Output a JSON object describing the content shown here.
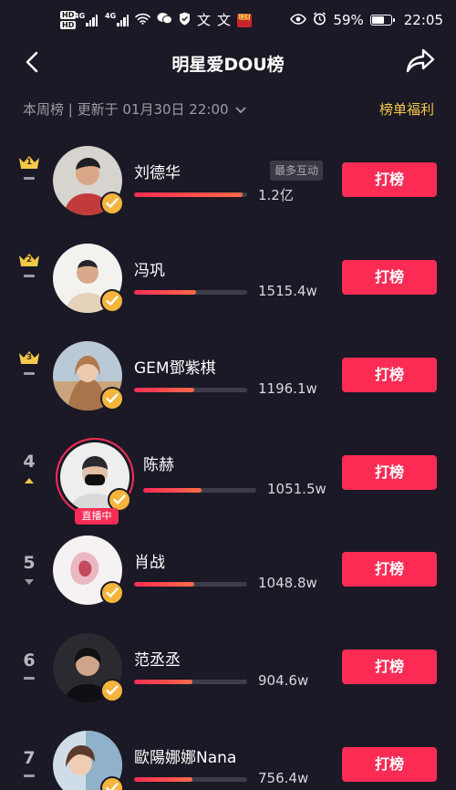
{
  "status_bar": {
    "hd_top": "HD",
    "hd_bottom": "HD",
    "network_1": "4G",
    "network_2": "4G",
    "tag_text": "理财",
    "battery": "59%",
    "time": "22:05"
  },
  "header": {
    "title": "明星爱DOU榜"
  },
  "subheader": {
    "week_info": "本周榜 | 更新于 01月30日 22:00",
    "benefit_link": "榜单福利"
  },
  "colors": {
    "background": "#1a1925",
    "accent": "#fe2c55",
    "gold": "#f4c84a",
    "muted_text": "#9d9ca5"
  },
  "ranking": [
    {
      "rank": "1",
      "name": "刘德华",
      "score": "1.2亿",
      "tag": "最多互动",
      "progress": 0.96,
      "trend": "flat",
      "live": false,
      "button_label": "打榜",
      "avatar_color": "#c23b3b"
    },
    {
      "rank": "2",
      "name": "冯巩",
      "score": "1515.4w",
      "tag": "",
      "progress": 0.55,
      "trend": "flat",
      "live": false,
      "button_label": "打榜",
      "avatar_color": "#e8d9c2"
    },
    {
      "rank": "3",
      "name": "GEM鄧紫棋",
      "score": "1196.1w",
      "tag": "",
      "progress": 0.53,
      "trend": "flat",
      "live": false,
      "button_label": "打榜",
      "avatar_color": "#c89b6e"
    },
    {
      "rank": "4",
      "name": "陈赫",
      "score": "1051.5w",
      "tag": "",
      "progress": 0.52,
      "trend": "up",
      "live": true,
      "live_label": "直播中",
      "button_label": "打榜",
      "avatar_color": "#e9e9e9"
    },
    {
      "rank": "5",
      "name": "肖战",
      "score": "1048.8w",
      "tag": "",
      "progress": 0.53,
      "trend": "down",
      "live": false,
      "button_label": "打榜",
      "avatar_color": "#f1e9ea"
    },
    {
      "rank": "6",
      "name": "范丞丞",
      "score": "904.6w",
      "tag": "",
      "progress": 0.52,
      "trend": "flat",
      "live": false,
      "button_label": "打榜",
      "avatar_color": "#2a2a30"
    },
    {
      "rank": "7",
      "name": "歐陽娜娜Nana",
      "score": "756.4w",
      "tag": "",
      "progress": 0.52,
      "trend": "flat",
      "live": false,
      "button_label": "打榜",
      "avatar_color": "#8fb1c9"
    }
  ]
}
